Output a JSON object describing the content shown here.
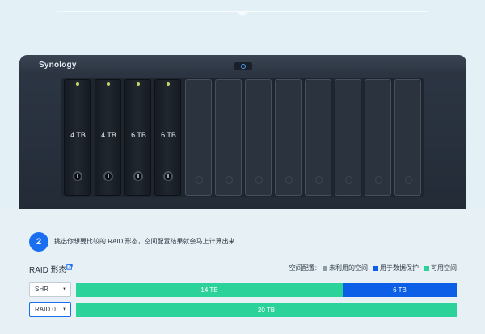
{
  "nas": {
    "brand": "Synology",
    "drives": [
      {
        "capacity": "4 TB",
        "filled": true
      },
      {
        "capacity": "4 TB",
        "filled": true
      },
      {
        "capacity": "6 TB",
        "filled": true
      },
      {
        "capacity": "6 TB",
        "filled": true
      },
      {
        "capacity": "",
        "filled": false
      },
      {
        "capacity": "",
        "filled": false
      },
      {
        "capacity": "",
        "filled": false
      },
      {
        "capacity": "",
        "filled": false
      },
      {
        "capacity": "",
        "filled": false
      },
      {
        "capacity": "",
        "filled": false
      },
      {
        "capacity": "",
        "filled": false
      },
      {
        "capacity": "",
        "filled": false
      }
    ]
  },
  "step": {
    "number": "2",
    "instruction": "挑选你想要比较的 RAID 形态，空间配置结果就会马上计算出来"
  },
  "raid": {
    "title": "RAID 形态",
    "legend": {
      "label": "空间配置:",
      "unused": "未利用的空间",
      "protection": "用于数据保护",
      "available": "可用空间",
      "colors": {
        "unused": "#8e9aa6",
        "protection": "#0d5fe8",
        "available": "#2bd39a"
      }
    },
    "rows": [
      {
        "type": "SHR",
        "segments": [
          {
            "label": "14 TB",
            "kind": "available",
            "value_tb": 14
          },
          {
            "label": "6 TB",
            "kind": "protection",
            "value_tb": 6
          }
        ]
      },
      {
        "type": "RAID 0",
        "segments": [
          {
            "label": "20 TB",
            "kind": "available",
            "value_tb": 20
          }
        ]
      }
    ]
  }
}
